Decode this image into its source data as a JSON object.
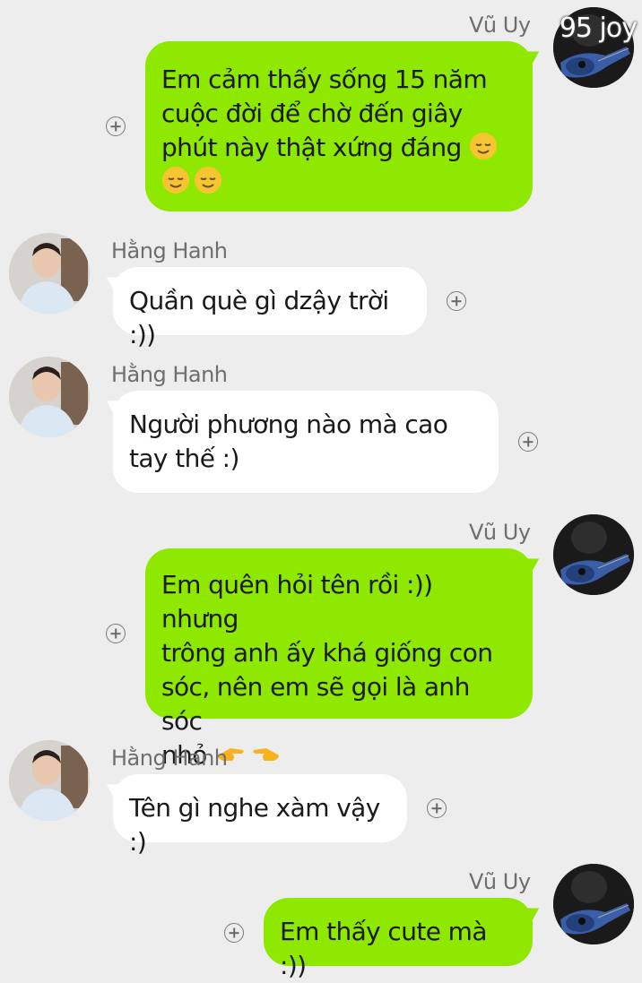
{
  "watermark": "95 joy",
  "messages": [
    {
      "sender": "Vũ Uy",
      "side": "right",
      "lines": [
        "Em cảm thấy sống 15 năm",
        "cuộc đời để chờ đến giây",
        "phút  này thật xứng đáng"
      ],
      "emoji": "relieved-face-emoji x3"
    },
    {
      "sender": "Hằng Hanh",
      "side": "left",
      "lines": [
        "Quần què gì dzậy trời :))"
      ]
    },
    {
      "sender": "Hằng Hanh",
      "side": "left",
      "lines": [
        "Người phương nào mà cao",
        "tay thế :)"
      ]
    },
    {
      "sender": "Vũ Uy",
      "side": "right",
      "lines": [
        "Em quên hỏi tên rồi :)) nhưng",
        "trông anh ấy khá giống con",
        "sóc, nên em sẽ gọi là anh sóc",
        "nhỏ"
      ],
      "emoji": "pointing-hand-emoji x2"
    },
    {
      "sender": "Hằng Hanh",
      "side": "left",
      "lines": [
        "Tên gì nghe xàm vậy :)"
      ]
    },
    {
      "sender": "Vũ Uy",
      "side": "right",
      "lines": [
        "Em thấy cute mà :))"
      ]
    }
  ],
  "colors": {
    "sent_bubble": "#8fe800",
    "received_bubble": "#ffffff",
    "background": "#ededed"
  }
}
